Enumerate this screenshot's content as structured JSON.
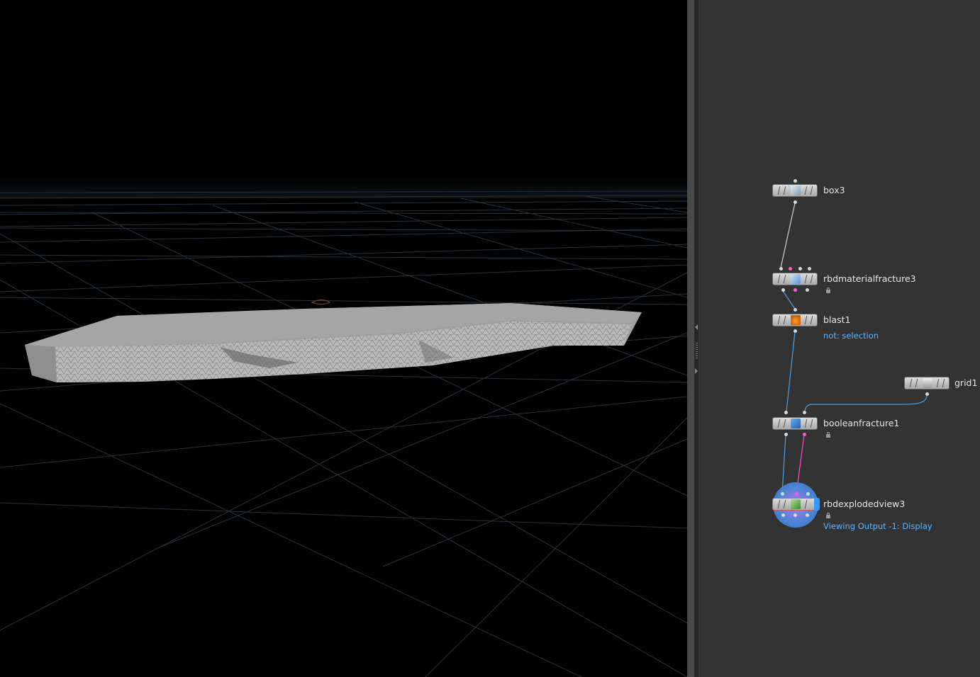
{
  "viewport": {
    "background": "#000000",
    "grid_color": "#2a3642",
    "geometry_color": "#b8b8b8"
  },
  "network": {
    "background": "#333333",
    "nodes": [
      {
        "id": "box3",
        "label": "box3",
        "icon": "box-icon"
      },
      {
        "id": "rbdmaterialfracture3",
        "label": "rbdmaterialfracture3",
        "icon": "rbd-material-fracture-icon",
        "locked": true
      },
      {
        "id": "blast1",
        "label": "blast1",
        "icon": "blast-icon",
        "sub": "not: selection"
      },
      {
        "id": "grid1",
        "label": "grid1",
        "icon": "grid-icon"
      },
      {
        "id": "booleanfracture1",
        "label": "booleanfracture1",
        "icon": "boolean-fracture-icon",
        "locked": true
      },
      {
        "id": "rbdexplodedview3",
        "label": "rbdexplodedview3",
        "icon": "exploded-view-icon",
        "locked": true,
        "sub": "Viewing Output -1: Display",
        "display": true
      }
    ],
    "wire_colors": {
      "default": "#d0d0d0",
      "blue": "#4aa0e6",
      "pink": "#ff4ad0"
    }
  }
}
